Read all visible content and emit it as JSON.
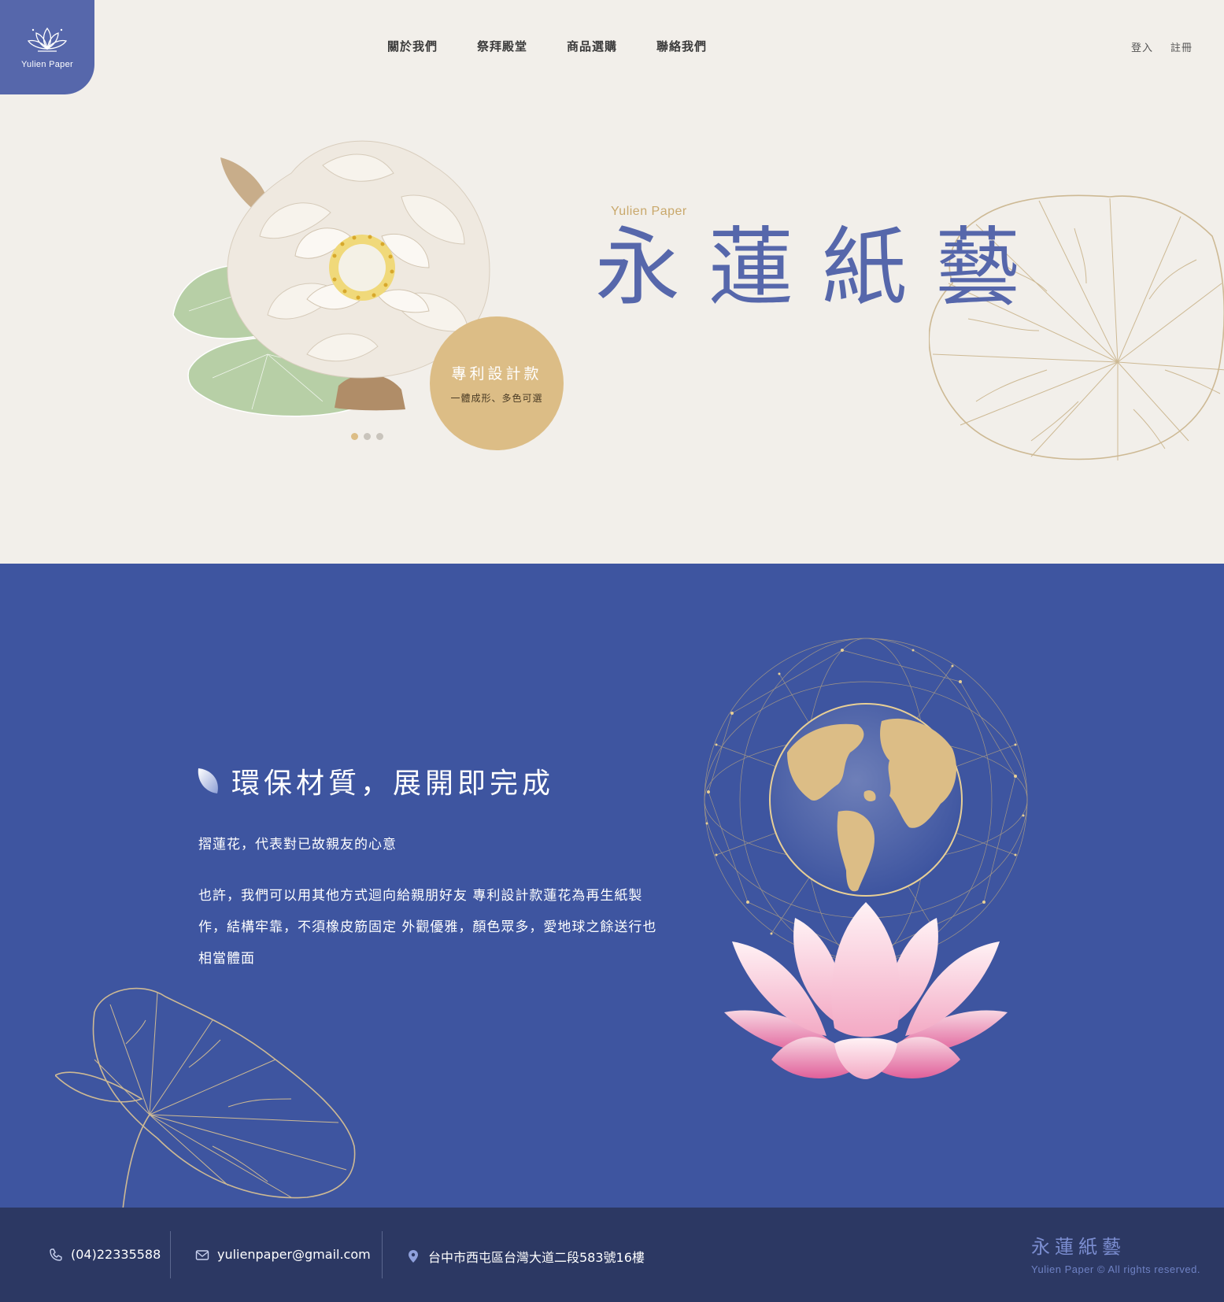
{
  "brand": {
    "logo_text": "Yulien Paper"
  },
  "nav": [
    "關於我們",
    "祭拜殿堂",
    "商品選購",
    "聯絡我們"
  ],
  "auth": {
    "login": "登入",
    "register": "註冊"
  },
  "hero": {
    "subtitle": "Yulien Paper",
    "title": "永蓮紙藝",
    "badge_title": "專利設計款",
    "badge_sub": "一體成形、多色可選",
    "slides": {
      "count": 3,
      "active": 0
    }
  },
  "eco": {
    "title": "環保材質，展開即完成",
    "lead": "摺蓮花，代表對已故親友的心意",
    "body": "也許，我們可以用其他方式迴向給親朋好友 專利設計款蓮花為再生紙製作，結構牢靠，不須橡皮筋固定 外觀優雅，顏色眾多，愛地球之餘送行也相當體面"
  },
  "footer": {
    "phone": "(04)22335588",
    "email": "yulienpaper@gmail.com",
    "address": "台中市西屯區台灣大道二段583號16樓",
    "brand_title": "永蓮紙藝",
    "copyright": "Yulien Paper © All rights reserved."
  },
  "colors": {
    "primary": "#5667ab",
    "gold": "#dcbd86",
    "section_bg": "#3e55a0",
    "footer_bg": "#2c3863",
    "page_bg": "#f2efea"
  },
  "icons": [
    "lotus-logo-icon",
    "leaf-icon",
    "phone-icon",
    "mail-icon",
    "location-icon"
  ]
}
